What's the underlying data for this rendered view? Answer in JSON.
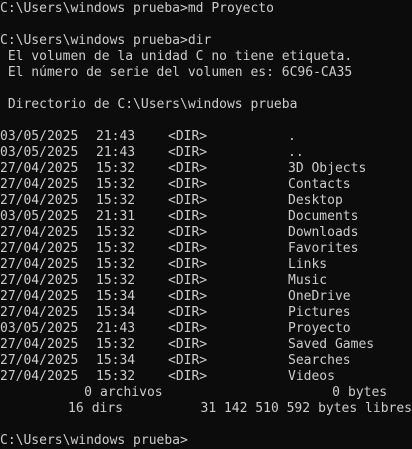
{
  "commands": {
    "first": "C:\\Users\\windows prueba>md Proyecto",
    "second": "C:\\Users\\windows prueba>dir",
    "final_prompt": "C:\\Users\\windows prueba>"
  },
  "volume": {
    "label_line": " El volumen de la unidad C no tiene etiqueta.",
    "serial_line": " El número de serie del volumen es: 6C96-CA35"
  },
  "directory_header": " Directorio de C:\\Users\\windows prueba",
  "entries": [
    {
      "date": "03/05/2025",
      "time": "21:43",
      "type": "<DIR>",
      "name": "."
    },
    {
      "date": "03/05/2025",
      "time": "21:43",
      "type": "<DIR>",
      "name": ".."
    },
    {
      "date": "27/04/2025",
      "time": "15:32",
      "type": "<DIR>",
      "name": "3D Objects"
    },
    {
      "date": "27/04/2025",
      "time": "15:32",
      "type": "<DIR>",
      "name": "Contacts"
    },
    {
      "date": "27/04/2025",
      "time": "15:32",
      "type": "<DIR>",
      "name": "Desktop"
    },
    {
      "date": "03/05/2025",
      "time": "21:31",
      "type": "<DIR>",
      "name": "Documents"
    },
    {
      "date": "27/04/2025",
      "time": "15:32",
      "type": "<DIR>",
      "name": "Downloads"
    },
    {
      "date": "27/04/2025",
      "time": "15:32",
      "type": "<DIR>",
      "name": "Favorites"
    },
    {
      "date": "27/04/2025",
      "time": "15:32",
      "type": "<DIR>",
      "name": "Links"
    },
    {
      "date": "27/04/2025",
      "time": "15:32",
      "type": "<DIR>",
      "name": "Music"
    },
    {
      "date": "27/04/2025",
      "time": "15:34",
      "type": "<DIR>",
      "name": "OneDrive"
    },
    {
      "date": "27/04/2025",
      "time": "15:34",
      "type": "<DIR>",
      "name": "Pictures"
    },
    {
      "date": "03/05/2025",
      "time": "21:43",
      "type": "<DIR>",
      "name": "Proyecto"
    },
    {
      "date": "27/04/2025",
      "time": "15:32",
      "type": "<DIR>",
      "name": "Saved Games"
    },
    {
      "date": "27/04/2025",
      "time": "15:34",
      "type": "<DIR>",
      "name": "Searches"
    },
    {
      "date": "27/04/2025",
      "time": "15:32",
      "type": "<DIR>",
      "name": "Videos"
    }
  ],
  "summary": {
    "files_count": "0",
    "files_label": "archivos",
    "files_bytes": "0",
    "files_bytes_label": "bytes",
    "dirs_count": "16",
    "dirs_label": "dirs",
    "free_bytes": "31 142 510 592",
    "free_label": "bytes libres"
  },
  "colors": {
    "background": "#0c0c0c",
    "text": "#cccccc"
  }
}
